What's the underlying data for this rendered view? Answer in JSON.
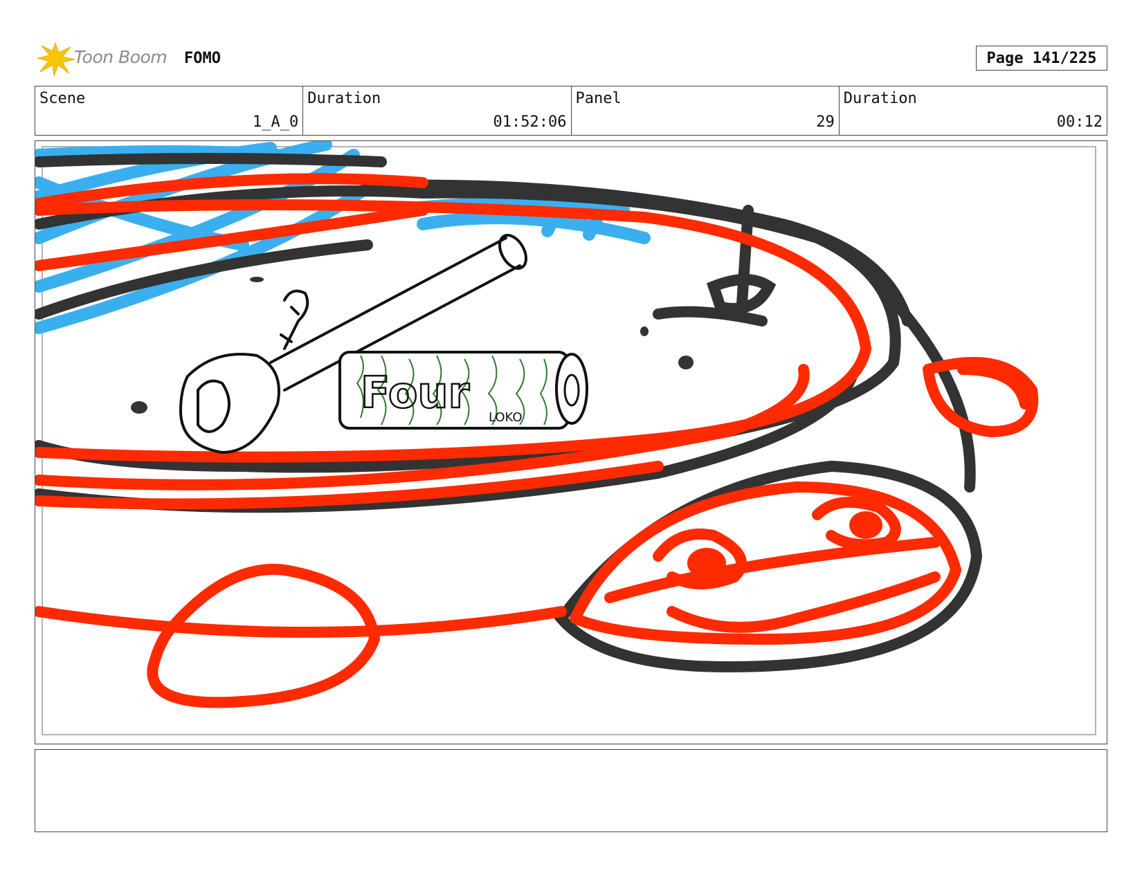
{
  "header": {
    "brand": "Toon Boom",
    "project": "FOMO",
    "page": "Page 141/225"
  },
  "info": {
    "scene_label": "Scene",
    "scene_value": "1_A_0",
    "duration_label": "Duration",
    "duration_value": "01:52:06",
    "panel_label": "Panel",
    "panel_value": "29",
    "panel_duration_label": "Duration",
    "panel_duration_value": "00:12"
  },
  "drawing": {
    "can_text": "Four",
    "can_subtext": "LOKO",
    "colors": {
      "red": "#ff2a00",
      "blue": "#3aaff0",
      "dark": "#333333",
      "green": "#2f7a2a"
    }
  },
  "notes": {
    "text": ""
  }
}
